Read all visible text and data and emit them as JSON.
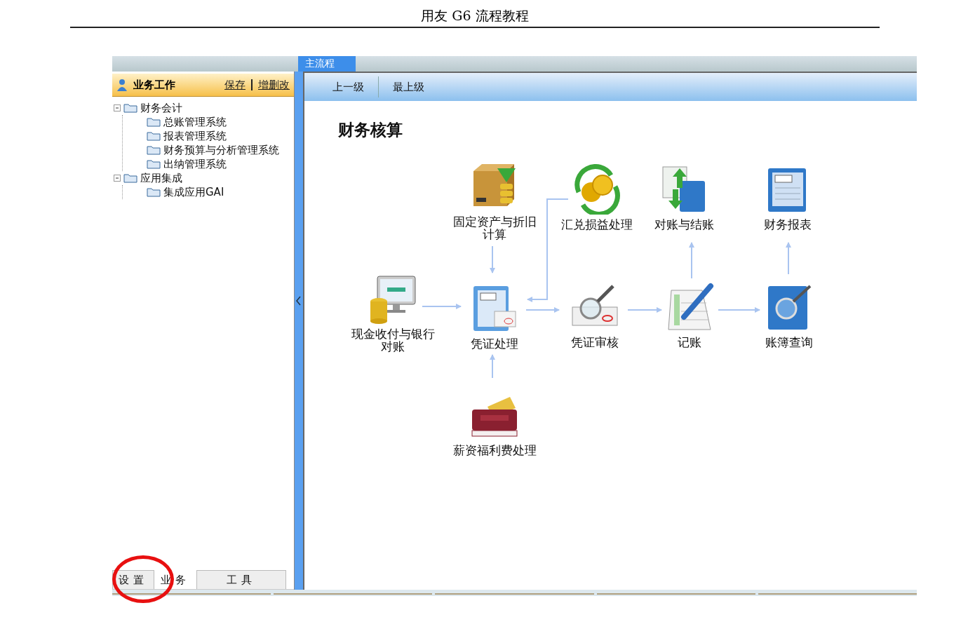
{
  "document_header": {
    "title": "用友 G6 流程教程"
  },
  "top_tabs": [
    {
      "label": "主流程",
      "selected": true
    }
  ],
  "sidebar": {
    "title": "业务工作",
    "actions": [
      "保存",
      "增删改"
    ],
    "tree": [
      {
        "label": "财务会计",
        "expanded": true,
        "children": [
          {
            "label": "总账管理系统"
          },
          {
            "label": "报表管理系统"
          },
          {
            "label": "财务预算与分析管理系统"
          },
          {
            "label": "出纳管理系统"
          }
        ]
      },
      {
        "label": "应用集成",
        "expanded": true,
        "children": [
          {
            "label": "集成应用GAI"
          }
        ]
      }
    ]
  },
  "toolbar": {
    "buttons": [
      "上一级",
      "最上级"
    ]
  },
  "canvas": {
    "title": "财务核算",
    "nodes": [
      {
        "label": "固定资产与折旧计算",
        "kind": "asset"
      },
      {
        "label": "汇兑损益处理",
        "kind": "currency"
      },
      {
        "label": "对账与结账",
        "kind": "reconcile"
      },
      {
        "label": "财务报表",
        "kind": "report"
      },
      {
        "label": "现金收付与银行对账",
        "kind": "cash"
      },
      {
        "label": "凭证处理",
        "kind": "voucher"
      },
      {
        "label": "凭证审核",
        "kind": "audit"
      },
      {
        "label": "记账",
        "kind": "posting"
      },
      {
        "label": "账簿查询",
        "kind": "ledger"
      },
      {
        "label": "薪资福利费处理",
        "kind": "payroll"
      }
    ]
  },
  "bottom_tabs": [
    {
      "label": "设置",
      "selected": false
    },
    {
      "label": "业务",
      "selected": true
    },
    {
      "label": "工具",
      "selected": false
    }
  ]
}
